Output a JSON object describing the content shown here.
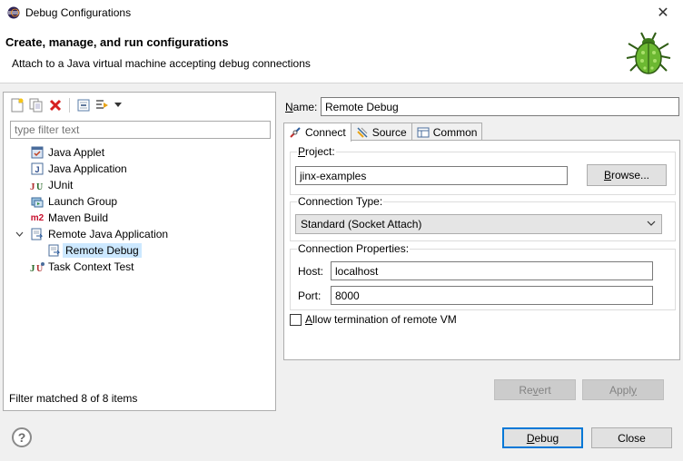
{
  "window": {
    "title": "Debug Configurations"
  },
  "banner": {
    "title": "Create, manage, and run configurations",
    "description": "Attach to a Java virtual machine accepting debug connections"
  },
  "left": {
    "toolbar": [
      "new-configuration-icon",
      "duplicate-icon",
      "delete-icon",
      "collapse-all-icon",
      "filter-icon",
      "dropdown-arrow-icon"
    ],
    "filter_placeholder": "type filter text",
    "tree": [
      {
        "label": "Java Applet",
        "icon": "java-applet-icon"
      },
      {
        "label": "Java Application",
        "icon": "java-application-icon"
      },
      {
        "label": "JUnit",
        "icon": "junit-icon"
      },
      {
        "label": "Launch Group",
        "icon": "launch-group-icon"
      },
      {
        "label": "Maven Build",
        "icon": "maven-icon"
      },
      {
        "label": "Remote Java Application",
        "icon": "remote-java-icon",
        "expanded": true
      },
      {
        "label": "Remote Debug",
        "icon": "remote-debug-icon",
        "selected": true
      },
      {
        "label": "Task Context Test",
        "icon": "task-context-test-icon"
      }
    ],
    "status": "Filter matched 8 of 8 items"
  },
  "right": {
    "name_label": "Name:",
    "name_value": "Remote Debug",
    "tabs": [
      {
        "label": "Connect",
        "active": true
      },
      {
        "label": "Source"
      },
      {
        "label": "Common"
      }
    ],
    "project_group": "Project:",
    "project_value": "jinx-examples",
    "browse_label": "Browse...",
    "connection_type_group": "Connection Type:",
    "connection_type_value": "Standard (Socket Attach)",
    "connection_props_group": "Connection Properties:",
    "host_label": "Host:",
    "host_value": "localhost",
    "port_label": "Port:",
    "port_value": "8000",
    "allow_termination_label": "Allow termination of remote VM",
    "allow_termination_checked": false,
    "revert_label": "Revert",
    "apply_label": "Apply"
  },
  "footer": {
    "debug_label": "Debug",
    "close_label": "Close"
  },
  "colors": {
    "selection": "#cce8ff",
    "default_button_border": "#0078d7"
  }
}
